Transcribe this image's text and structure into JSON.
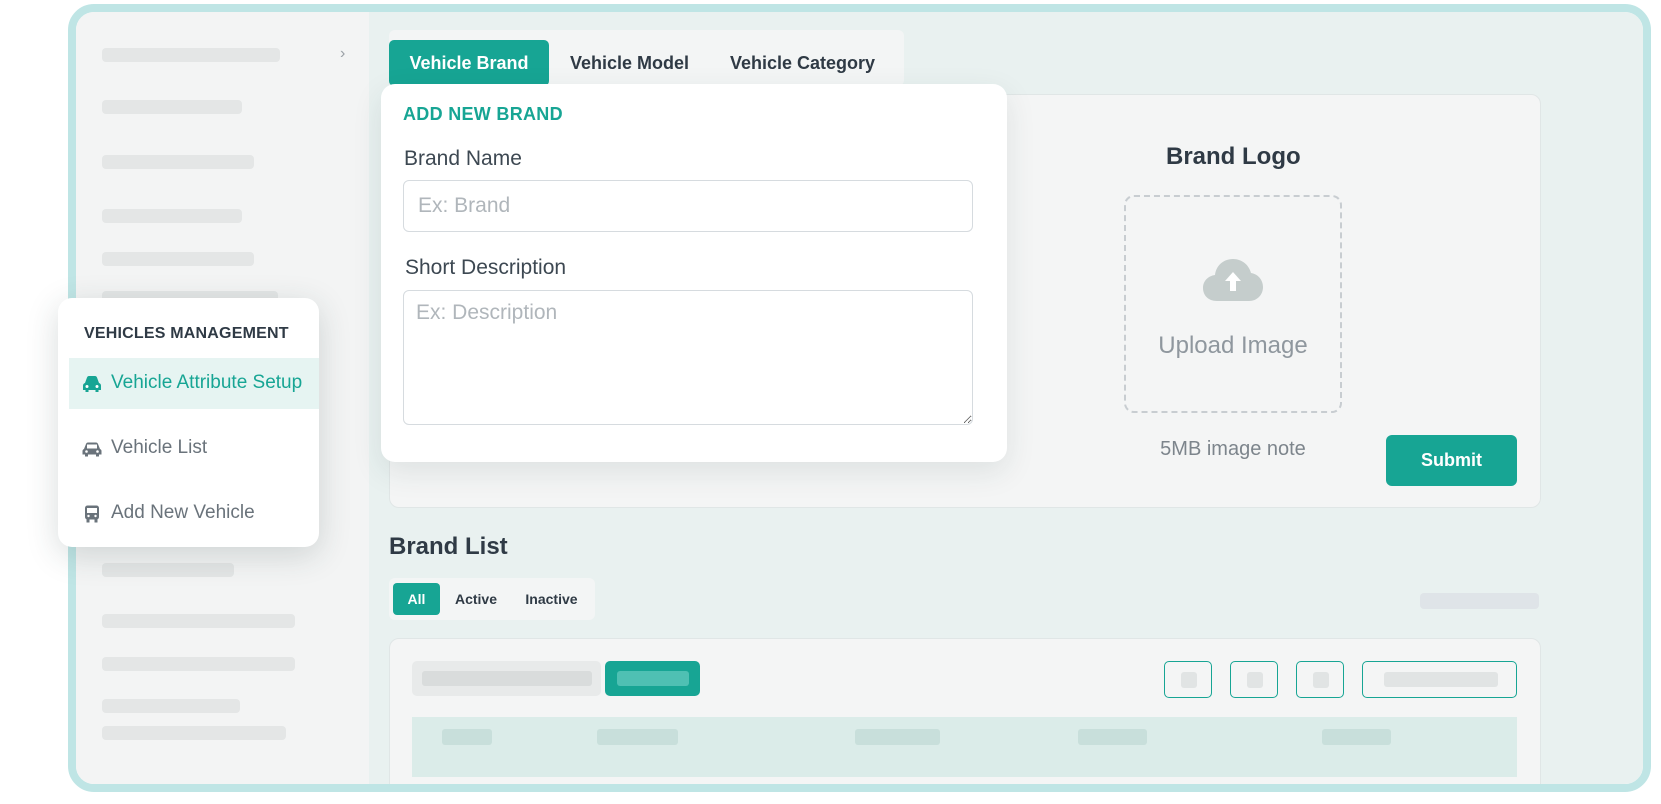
{
  "tabs": [
    {
      "label": "Vehicle Brand",
      "active": true
    },
    {
      "label": "Vehicle Model",
      "active": false
    },
    {
      "label": "Vehicle Category",
      "active": false
    }
  ],
  "form": {
    "title": "ADD NEW BRAND",
    "brand_name_label": "Brand Name",
    "brand_name_placeholder": "Ex: Brand",
    "short_description_label": "Short Description",
    "short_description_placeholder": "Ex: Description"
  },
  "logo": {
    "title": "Brand Logo",
    "upload_text": "Upload Image",
    "note": "5MB image note",
    "icon": "cloud-upload-icon"
  },
  "submit_label": "Submit",
  "menu": {
    "heading": "VEHICLES MANAGEMENT",
    "items": [
      {
        "label": "Vehicle Attribute Setup",
        "icon": "car-front-icon",
        "active": true
      },
      {
        "label": "Vehicle List",
        "icon": "car-icon",
        "active": false
      },
      {
        "label": "Add New Vehicle",
        "icon": "bus-icon",
        "active": false
      }
    ]
  },
  "brand_list": {
    "title": "Brand List",
    "filters": [
      {
        "label": "All",
        "active": true
      },
      {
        "label": "Active",
        "active": false
      },
      {
        "label": "Inactive",
        "active": false
      }
    ]
  },
  "colors": {
    "accent": "#17a594",
    "frame_border": "#bfe5e5",
    "text_dark": "#2f3a45"
  }
}
